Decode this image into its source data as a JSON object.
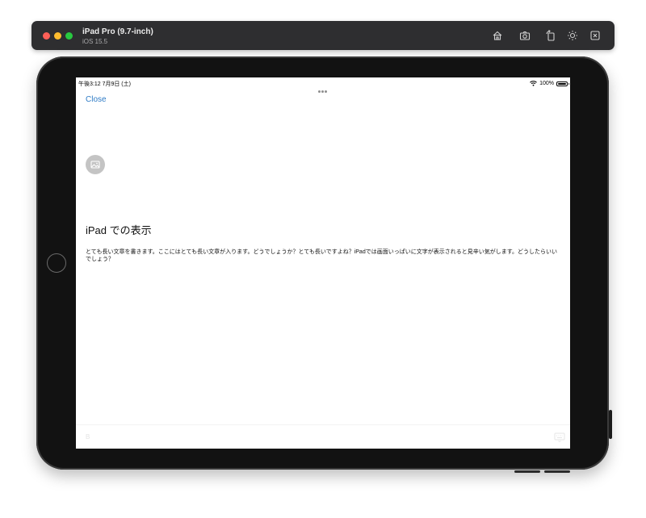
{
  "window": {
    "title": "iPad Pro (9.7-inch)",
    "subtitle": "iOS 15.5",
    "toolbar_icons": [
      "home-icon",
      "screenshot-icon",
      "rotate-icon",
      "appearance-icon",
      "close-window-icon"
    ]
  },
  "statusbar": {
    "time": "午後3:12   7月9日 (土)",
    "battery": "100%",
    "battery_level": 1.0
  },
  "app": {
    "close_label": "Close",
    "heading": "iPad での表示",
    "body": "とても長い文章を書きます。ここにはとても長い文章が入ります。どうでしょうか？とても長いですよね？iPadでは画面いっぱいに文字が表示されると見辛い気がします。どうしたらいいでしょう？",
    "bottom_left_glyph": "B"
  },
  "colors": {
    "link": "#2e7bc6",
    "title_bar": "#2e2e30",
    "device_body": "#121212"
  }
}
